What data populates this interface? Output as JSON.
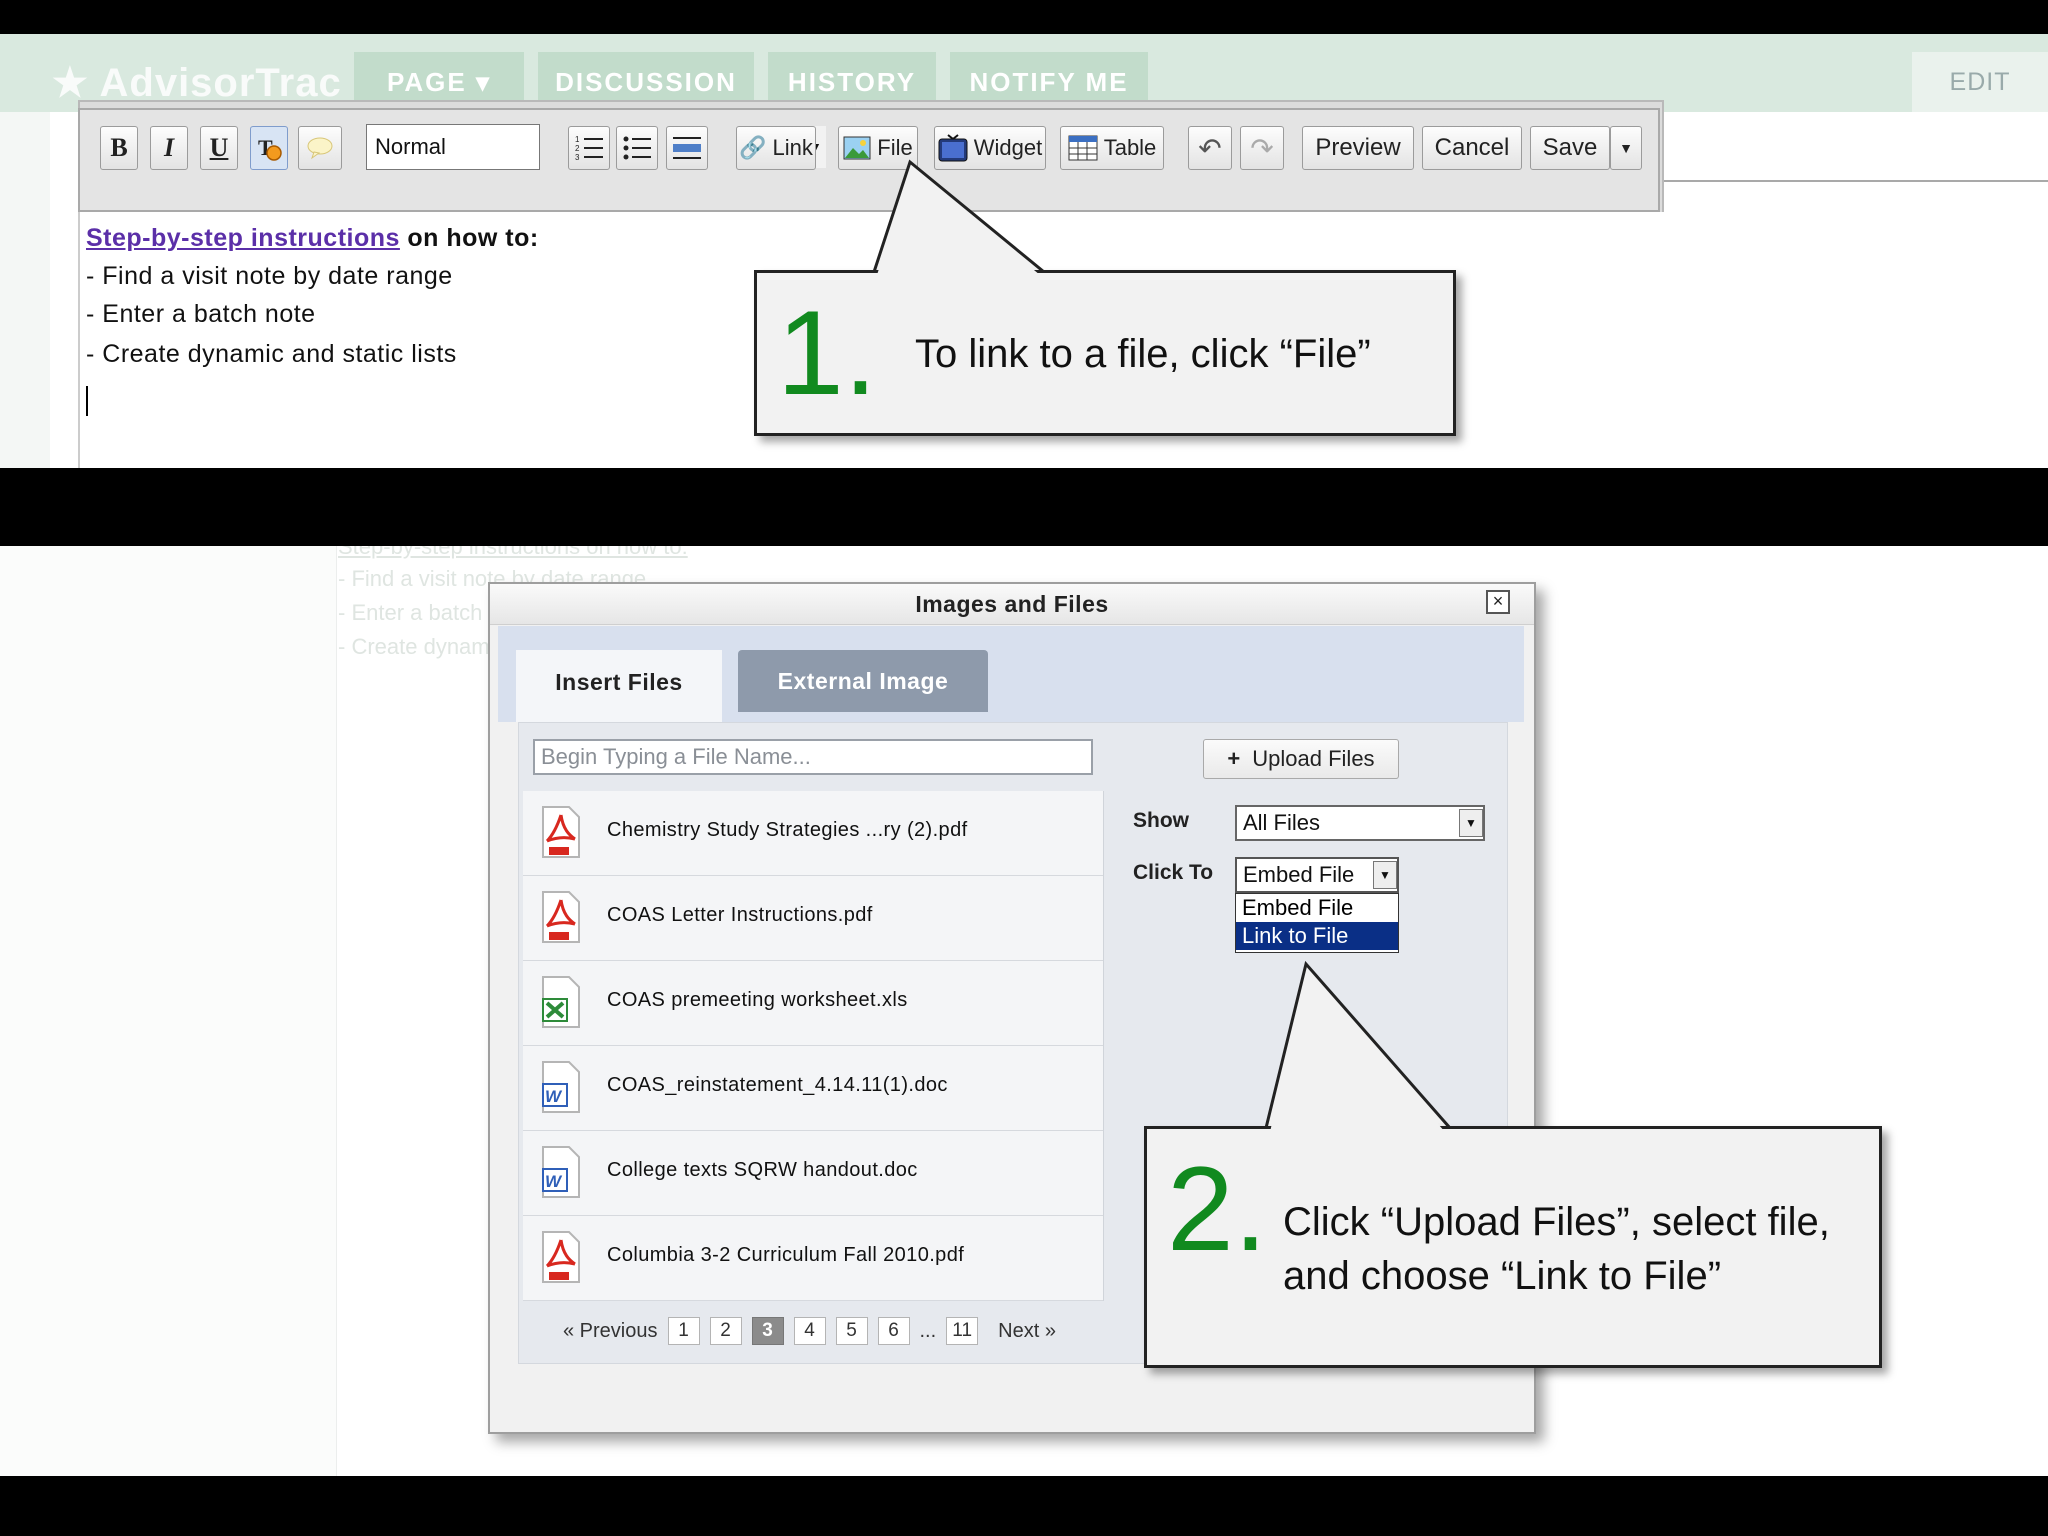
{
  "top": {
    "app_logo": "AdvisorTrac",
    "nav_tabs": [
      "PAGE",
      "DISCUSSION",
      "HISTORY",
      "NOTIFY ME"
    ],
    "edit_tab": "EDIT",
    "toolbar": {
      "bold": "B",
      "italic": "I",
      "underline": "U",
      "style_value": "Normal",
      "link_label": "Link",
      "file_label": "File",
      "widget_label": "Widget",
      "table_label": "Table",
      "preview_label": "Preview",
      "cancel_label": "Cancel",
      "save_label": "Save"
    },
    "editor": {
      "link_text": "Step-by-step instructions",
      "heading_rest": " on how to:",
      "lines": [
        "- Find a visit note by date range",
        "- Enter a batch note",
        "- Create dynamic and static lists"
      ]
    },
    "callout1": {
      "number": "1.",
      "text": "To link to a file, click “File”"
    }
  },
  "bottom": {
    "background": {
      "editor_lines": [
        "Step-by-step instructions on how to:",
        "- Find a visit note by date range",
        "- Enter a batch",
        "- Create dynam"
      ]
    },
    "dialog": {
      "title": "Images and Files",
      "close": "×",
      "tabs": [
        "Insert Files",
        "External Image"
      ],
      "search_placeholder": "Begin Typing a File Name...",
      "upload_label": "Upload Files",
      "files": [
        {
          "name": "Chemistry Study Strategies ...ry (2).pdf",
          "type": "pdf"
        },
        {
          "name": "COAS Letter Instructions.pdf",
          "type": "pdf"
        },
        {
          "name": "COAS premeeting worksheet.xls",
          "type": "xls"
        },
        {
          "name": "COAS_reinstatement_4.14.11(1).doc",
          "type": "doc"
        },
        {
          "name": "College texts SQRW handout.doc",
          "type": "doc"
        },
        {
          "name": "Columbia 3-2 Curriculum Fall 2010.pdf",
          "type": "pdf"
        }
      ],
      "pager": {
        "prev": "« Previous",
        "pages": [
          "1",
          "2",
          "3",
          "4",
          "5",
          "6"
        ],
        "ellipsis": "...",
        "last": "11",
        "next": "Next »",
        "current": "3"
      },
      "show_label": "Show",
      "show_value": "All Files",
      "clickto_label": "Click To",
      "clickto_value": "Embed File",
      "clickto_options": [
        "Embed File",
        "Link to File"
      ]
    },
    "callout2": {
      "number": "2.",
      "text_line1": "Click “Upload Files”, select file,",
      "text_line2": "and choose “Link to File”"
    }
  }
}
